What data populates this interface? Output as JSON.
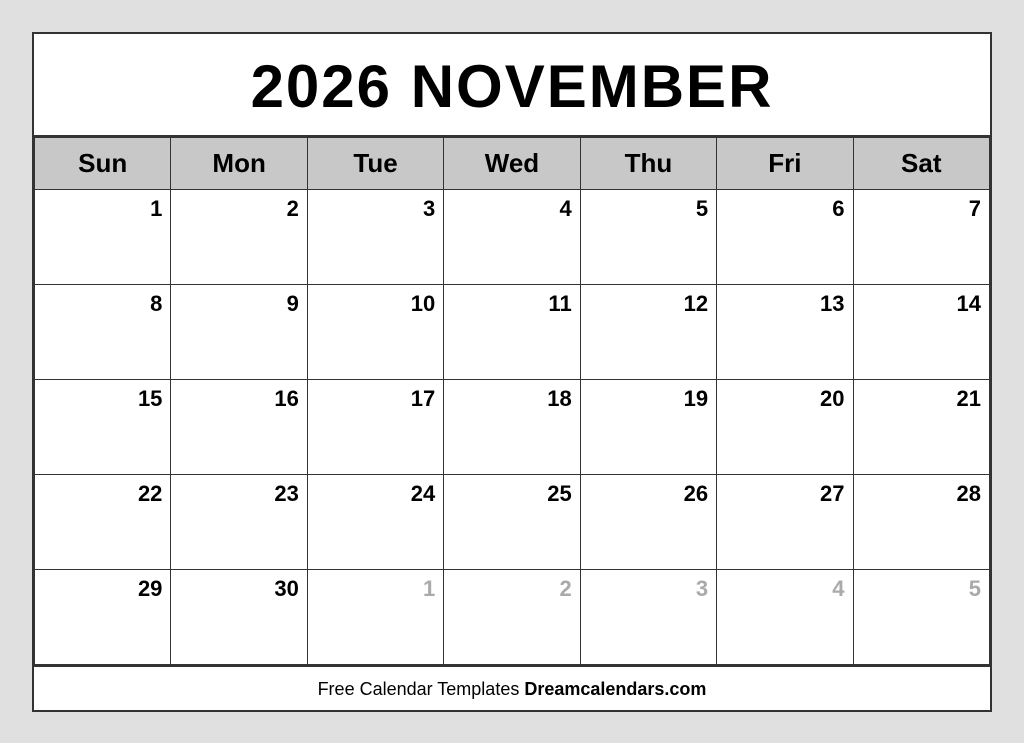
{
  "title": "2026 NOVEMBER",
  "year": "2026",
  "month": "NOVEMBER",
  "days_of_week": [
    "Sun",
    "Mon",
    "Tue",
    "Wed",
    "Thu",
    "Fri",
    "Sat"
  ],
  "weeks": [
    [
      {
        "day": "1",
        "current": true
      },
      {
        "day": "2",
        "current": true
      },
      {
        "day": "3",
        "current": true
      },
      {
        "day": "4",
        "current": true
      },
      {
        "day": "5",
        "current": true
      },
      {
        "day": "6",
        "current": true
      },
      {
        "day": "7",
        "current": true
      }
    ],
    [
      {
        "day": "8",
        "current": true
      },
      {
        "day": "9",
        "current": true
      },
      {
        "day": "10",
        "current": true
      },
      {
        "day": "11",
        "current": true
      },
      {
        "day": "12",
        "current": true
      },
      {
        "day": "13",
        "current": true
      },
      {
        "day": "14",
        "current": true
      }
    ],
    [
      {
        "day": "15",
        "current": true
      },
      {
        "day": "16",
        "current": true
      },
      {
        "day": "17",
        "current": true
      },
      {
        "day": "18",
        "current": true
      },
      {
        "day": "19",
        "current": true
      },
      {
        "day": "20",
        "current": true
      },
      {
        "day": "21",
        "current": true
      }
    ],
    [
      {
        "day": "22",
        "current": true
      },
      {
        "day": "23",
        "current": true
      },
      {
        "day": "24",
        "current": true
      },
      {
        "day": "25",
        "current": true
      },
      {
        "day": "26",
        "current": true
      },
      {
        "day": "27",
        "current": true
      },
      {
        "day": "28",
        "current": true
      }
    ],
    [
      {
        "day": "29",
        "current": true
      },
      {
        "day": "30",
        "current": true
      },
      {
        "day": "1",
        "current": false
      },
      {
        "day": "2",
        "current": false
      },
      {
        "day": "3",
        "current": false
      },
      {
        "day": "4",
        "current": false
      },
      {
        "day": "5",
        "current": false
      }
    ]
  ],
  "footer": {
    "normal_text": "Free Calendar Templates ",
    "bold_text": "Dreamcalendars.com"
  }
}
